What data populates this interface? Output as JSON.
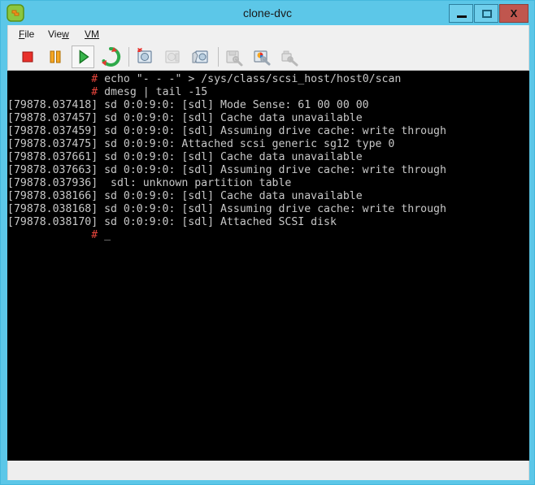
{
  "window": {
    "title": "clone-dvc",
    "app_icon": "vm-console-icon",
    "frame_color": "#5cc7e8",
    "controls": [
      {
        "name": "minimize-button",
        "label": "—"
      },
      {
        "name": "maximize-button",
        "label": "□"
      },
      {
        "name": "close-button",
        "label": "X",
        "color": "#c0564e"
      }
    ]
  },
  "menubar": {
    "items": [
      {
        "name": "menu-file",
        "label": "File",
        "accel": "F"
      },
      {
        "name": "menu-view",
        "label": "View",
        "accel": "w"
      },
      {
        "name": "menu-vm",
        "label": "VM",
        "accel": "VM"
      }
    ]
  },
  "toolbar": {
    "buttons": [
      {
        "name": "stop-button",
        "icon": "stop-icon",
        "tooltip": "Stop",
        "enabled": true
      },
      {
        "name": "pause-button",
        "icon": "pause-icon",
        "tooltip": "Pause",
        "enabled": true
      },
      {
        "name": "play-button",
        "icon": "play-icon",
        "tooltip": "Play",
        "enabled": true,
        "hovered": true
      },
      {
        "name": "restart-button",
        "icon": "restart-icon",
        "tooltip": "Restart",
        "enabled": true
      },
      {
        "name": "take-snapshot-button",
        "icon": "take-snapshot-icon",
        "tooltip": "Take Snapshot",
        "enabled": true
      },
      {
        "name": "revert-snapshot-button",
        "icon": "revert-snapshot-icon",
        "tooltip": "Revert to Snapshot",
        "enabled": false
      },
      {
        "name": "snapshot-manager-button",
        "icon": "snapshot-manager-icon",
        "tooltip": "Manage Snapshots",
        "enabled": true
      },
      {
        "name": "vm-settings-button",
        "icon": "vm-settings-icon",
        "tooltip": "VM Settings",
        "enabled": true
      },
      {
        "name": "display-settings-button",
        "icon": "display-settings-icon",
        "tooltip": "Display Settings",
        "enabled": true
      },
      {
        "name": "usb-settings-button",
        "icon": "usb-settings-icon",
        "tooltip": "USB Settings",
        "enabled": true
      }
    ]
  },
  "terminal": {
    "background": "#000000",
    "foreground": "#c8c8c8",
    "prompt_color": "#e8453c",
    "prompt_symbol": "#",
    "prompt_indent": 13,
    "cursor": "_",
    "lines": [
      {
        "type": "command",
        "indent": "             ",
        "prompt": "#",
        "text": " echo \"- - -\" > /sys/class/scsi_host/host0/scan"
      },
      {
        "type": "command",
        "indent": "             ",
        "prompt": "#",
        "text": " dmesg | tail -15"
      },
      {
        "type": "output",
        "text": "[79878.037418] sd 0:0:9:0: [sdl] Mode Sense: 61 00 00 00"
      },
      {
        "type": "output",
        "text": "[79878.037457] sd 0:0:9:0: [sdl] Cache data unavailable"
      },
      {
        "type": "output",
        "text": "[79878.037459] sd 0:0:9:0: [sdl] Assuming drive cache: write through"
      },
      {
        "type": "output",
        "text": "[79878.037475] sd 0:0:9:0: Attached scsi generic sg12 type 0"
      },
      {
        "type": "output",
        "text": "[79878.037661] sd 0:0:9:0: [sdl] Cache data unavailable"
      },
      {
        "type": "output",
        "text": "[79878.037663] sd 0:0:9:0: [sdl] Assuming drive cache: write through"
      },
      {
        "type": "output",
        "text": "[79878.037936]  sdl: unknown partition table"
      },
      {
        "type": "output",
        "text": "[79878.038166] sd 0:0:9:0: [sdl] Cache data unavailable"
      },
      {
        "type": "output",
        "text": "[79878.038168] sd 0:0:9:0: [sdl] Assuming drive cache: write through"
      },
      {
        "type": "output",
        "text": "[79878.038170] sd 0:0:9:0: [sdl] Attached SCSI disk"
      },
      {
        "type": "prompt",
        "indent": "             ",
        "prompt": "#",
        "text": " ",
        "cursor": "_"
      }
    ]
  },
  "statusbar": {
    "text": ""
  }
}
